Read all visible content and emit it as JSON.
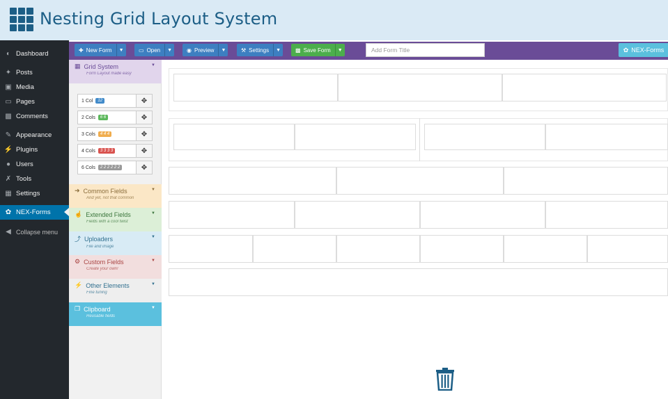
{
  "banner": {
    "title": "Nesting Grid Layout System",
    "logo_icon": "grid-icon"
  },
  "wp_menu": {
    "items": [
      {
        "label": "Dashboard",
        "icon": "dashboard-icon"
      },
      {
        "label": "Posts",
        "icon": "pin-icon"
      },
      {
        "label": "Media",
        "icon": "media-icon"
      },
      {
        "label": "Pages",
        "icon": "pages-icon"
      },
      {
        "label": "Comments",
        "icon": "comments-icon"
      },
      {
        "label": "Appearance",
        "icon": "brush-icon"
      },
      {
        "label": "Plugins",
        "icon": "plugin-icon"
      },
      {
        "label": "Users",
        "icon": "users-icon"
      },
      {
        "label": "Tools",
        "icon": "wrench-icon"
      },
      {
        "label": "Settings",
        "icon": "settings-icon"
      },
      {
        "label": "NEX-Forms",
        "icon": "flame-icon",
        "active": true
      }
    ],
    "collapse_label": "Collapse menu"
  },
  "toolbar": {
    "new_form": "New Form",
    "open": "Open",
    "preview": "Preview",
    "settings": "Settings",
    "save_form": "Save Form",
    "title_placeholder": "Add Form Title",
    "nexforms": "NEX-Forms"
  },
  "panel": {
    "grid_system": {
      "title": "Grid System",
      "subtitle": "Form Layout made easy"
    },
    "grid_tools": [
      {
        "label": "1 Col",
        "badge": "12",
        "color": "#428bca"
      },
      {
        "label": "2 Cols",
        "badge": "6 6",
        "color": "#5cb85c"
      },
      {
        "label": "3 Cols",
        "badge": "4 4 4",
        "color": "#f0ad4e"
      },
      {
        "label": "4 Cols",
        "badge": "3 3 3 3",
        "color": "#d9534f"
      },
      {
        "label": "6 Cols",
        "badge": "2 2 2 2 2 2",
        "color": "#999999"
      }
    ],
    "sections": [
      {
        "title": "Common Fields",
        "subtitle": "And yet, not that common",
        "icon": "arrow-right-icon"
      },
      {
        "title": "Extended Fields",
        "subtitle": "Fields with a cool twist",
        "icon": "thumbs-up-icon"
      },
      {
        "title": "Uploaders",
        "subtitle": "File and image",
        "icon": "upload-icon"
      },
      {
        "title": "Custom Fields",
        "subtitle": "Create your own!",
        "icon": "cog-icon"
      },
      {
        "title": "Other Elements",
        "subtitle": "Fine tuning",
        "icon": "bolt-icon"
      },
      {
        "title": "Clipboard",
        "subtitle": "Reusable fields",
        "icon": "clipboard-icon"
      }
    ]
  },
  "colors": {
    "toolbar_bg": "#6a4c97",
    "wp_sidebar_bg": "#23282d",
    "wp_active": "#0073aa",
    "banner_bg": "#daeaf5",
    "banner_text": "#1c5e86"
  }
}
